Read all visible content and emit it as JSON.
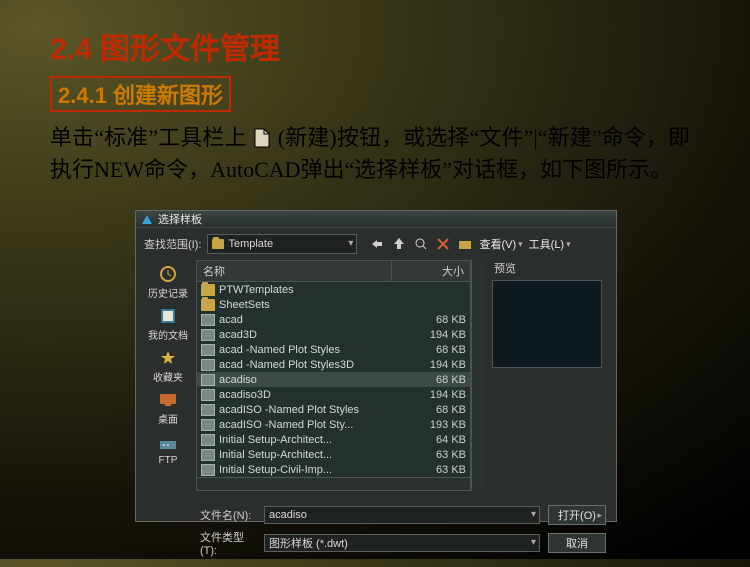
{
  "slide": {
    "heading": "2.4  图形文件管理",
    "subheading": "2.4.1  创建新图形",
    "para_before_icon": "单击“标准”工具栏上",
    "para_after_icon": "      (新建)按钮，或选择“文件”|“新建”命令，即执行NEW命令，AutoCAD弹出“选择样板”对话框，如下图所示。"
  },
  "dialog": {
    "title": "选择样板",
    "look_in_label": "查找范围(I):",
    "look_in_value": "Template",
    "toolbar": {
      "view_label": "查看(V)",
      "tools_label": "工具(L)"
    },
    "preview_label": "预览",
    "columns": {
      "name": "名称",
      "size": "大小"
    },
    "places": [
      {
        "label": "历史记录",
        "icon": "history"
      },
      {
        "label": "我的文档",
        "icon": "docs"
      },
      {
        "label": "收藏夹",
        "icon": "fav"
      },
      {
        "label": "桌面",
        "icon": "desktop"
      },
      {
        "label": "FTP",
        "icon": "ftp"
      }
    ],
    "files": [
      {
        "name": "PTWTemplates",
        "size": "",
        "type": "folder"
      },
      {
        "name": "SheetSets",
        "size": "",
        "type": "folder"
      },
      {
        "name": "acad",
        "size": "68 KB",
        "type": "file"
      },
      {
        "name": "acad3D",
        "size": "194 KB",
        "type": "file"
      },
      {
        "name": "acad -Named Plot Styles",
        "size": "68 KB",
        "type": "file"
      },
      {
        "name": "acad -Named Plot Styles3D",
        "size": "194 KB",
        "type": "file"
      },
      {
        "name": "acadiso",
        "size": "68 KB",
        "type": "file",
        "selected": true
      },
      {
        "name": "acadiso3D",
        "size": "194 KB",
        "type": "file"
      },
      {
        "name": "acadISO -Named Plot Styles",
        "size": "68 KB",
        "type": "file"
      },
      {
        "name": "acadISO -Named Plot Sty...",
        "size": "193 KB",
        "type": "file"
      },
      {
        "name": "Initial Setup-Architect...",
        "size": "64 KB",
        "type": "file"
      },
      {
        "name": "Initial Setup-Architect...",
        "size": "63 KB",
        "type": "file"
      },
      {
        "name": "Initial Setup-Civil-Imp...",
        "size": "63 KB",
        "type": "file"
      }
    ],
    "filename_label": "文件名(N):",
    "filename_value": "acadiso",
    "filetype_label": "文件类型(T):",
    "filetype_value": "图形样板 (*.dwt)",
    "open_btn": "打开(O)",
    "cancel_btn": "取消"
  }
}
